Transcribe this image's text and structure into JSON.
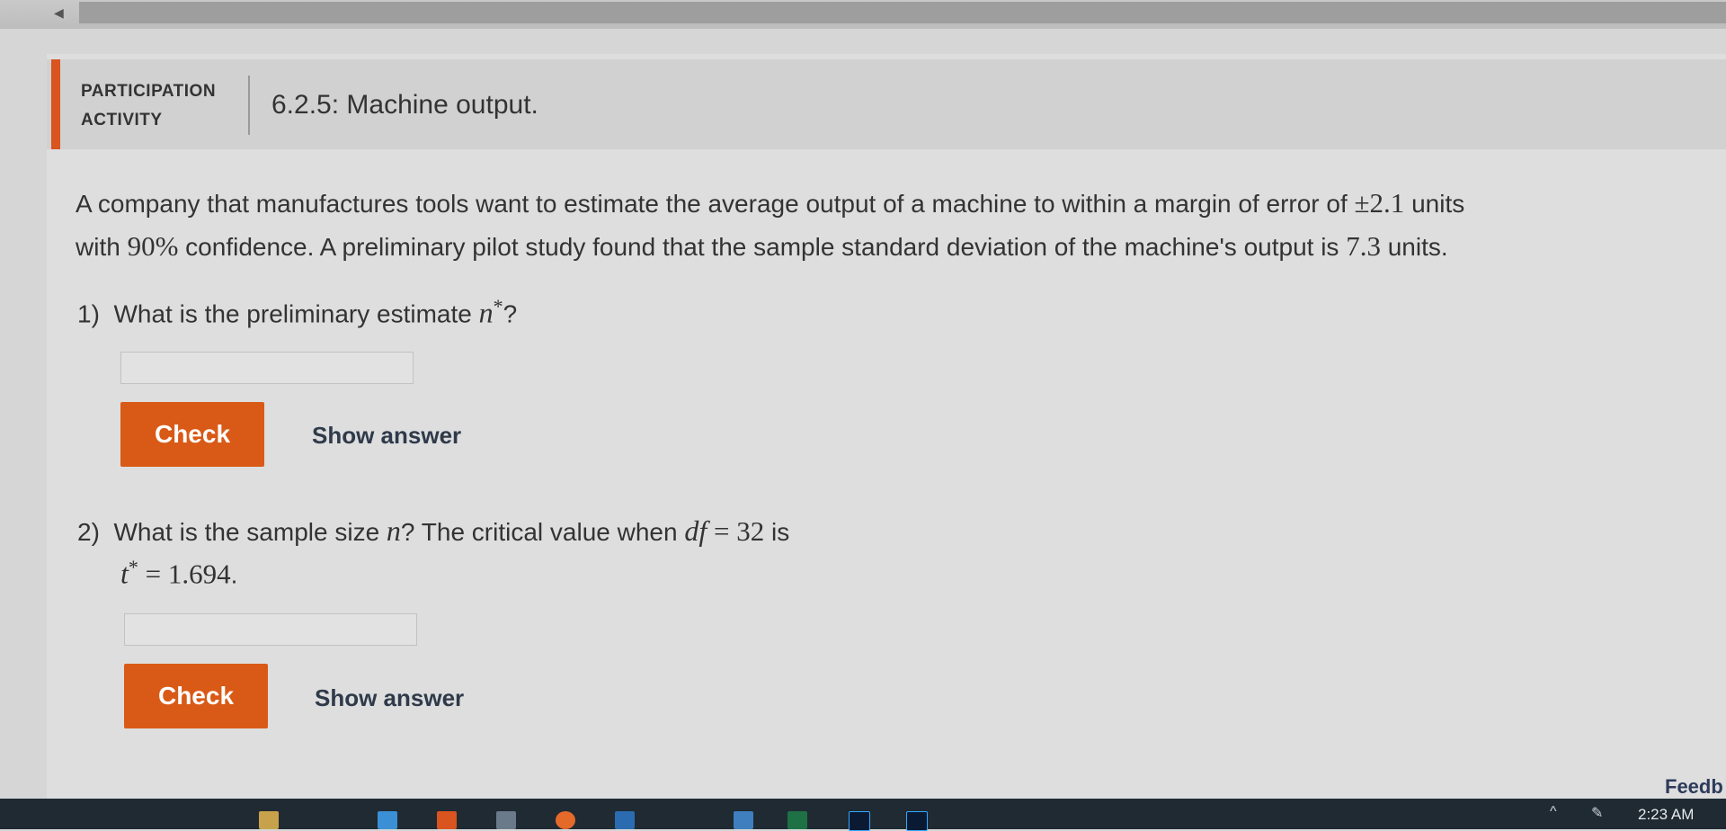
{
  "header": {
    "activity_line1": "PARTICIPATION",
    "activity_line2": "ACTIVITY",
    "title": "6.2.5: Machine output."
  },
  "problem": {
    "t1": "A company that manufactures tools want to estimate the average output of a machine to within a margin of error of ",
    "margin": "±2.1",
    "t2": " units",
    "t3": "with ",
    "confidence": "90%",
    "t4": " confidence. A preliminary pilot study found that the sample standard deviation of the machine's output is ",
    "sd": "7.3",
    "t5": " units."
  },
  "questions": [
    {
      "number": "1)",
      "text_a": "What is the preliminary estimate ",
      "var": "n",
      "sup": "*",
      "text_b": "?",
      "check_label": "Check",
      "show_label": "Show answer"
    },
    {
      "number": "2)",
      "text_a": "What is the sample size ",
      "var": "n",
      "text_b": "? The critical value when ",
      "df": "df",
      "eq": " = ",
      "df_val": "32",
      "text_c": " is",
      "tstar": "t",
      "tstar_sup": "*",
      "tval": " = 1.694",
      "period": ".",
      "check_label": "Check",
      "show_label": "Show answer"
    }
  ],
  "feedback_label": "Feedb",
  "taskbar": {
    "clock": "2:23 AM",
    "icons": [
      "app-icon",
      "app-icon",
      "app-icon",
      "app-icon",
      "app-icon",
      "app-icon",
      "app-icon",
      "excel-icon",
      "photoshop-icon",
      "lightroom-icon"
    ]
  },
  "colors": {
    "accent": "#d9541e",
    "check_button": "#d95a16",
    "taskbar": "#1f2a33"
  }
}
